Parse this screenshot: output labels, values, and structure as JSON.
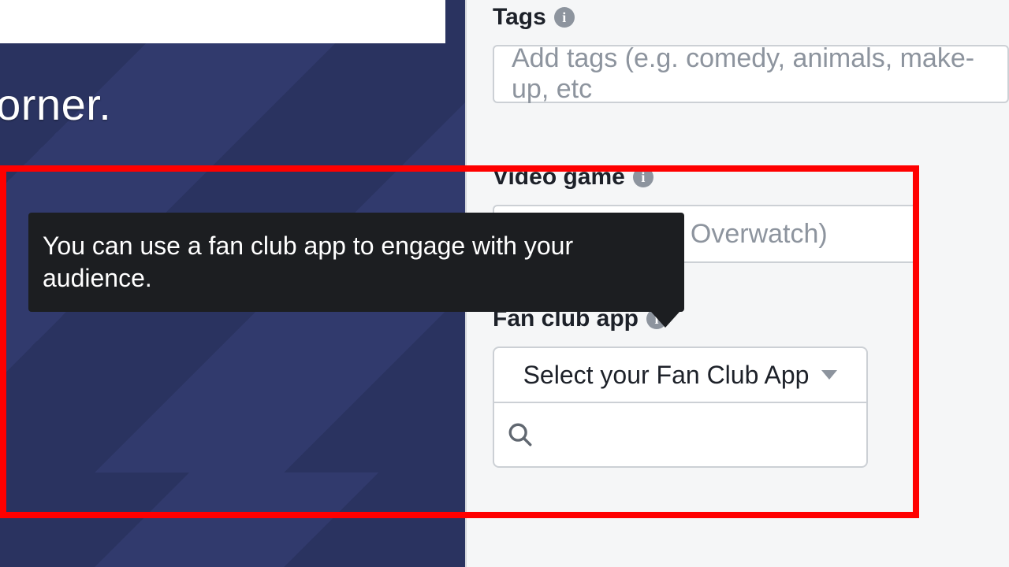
{
  "left": {
    "partial_text": "-right corner."
  },
  "tooltip": {
    "text": "You can use a fan club app to engage with your audience."
  },
  "form": {
    "tags": {
      "label": "Tags",
      "placeholder": "Add tags (e.g. comedy, animals, make-up, etc"
    },
    "video_game": {
      "label": "Video game",
      "placeholder_fragment": ". Overwatch)"
    },
    "fan_club": {
      "label": "Fan club app",
      "dropdown_label": "Select your Fan Club App",
      "search_value": ""
    }
  },
  "icons": {
    "info_glyph": "i"
  }
}
